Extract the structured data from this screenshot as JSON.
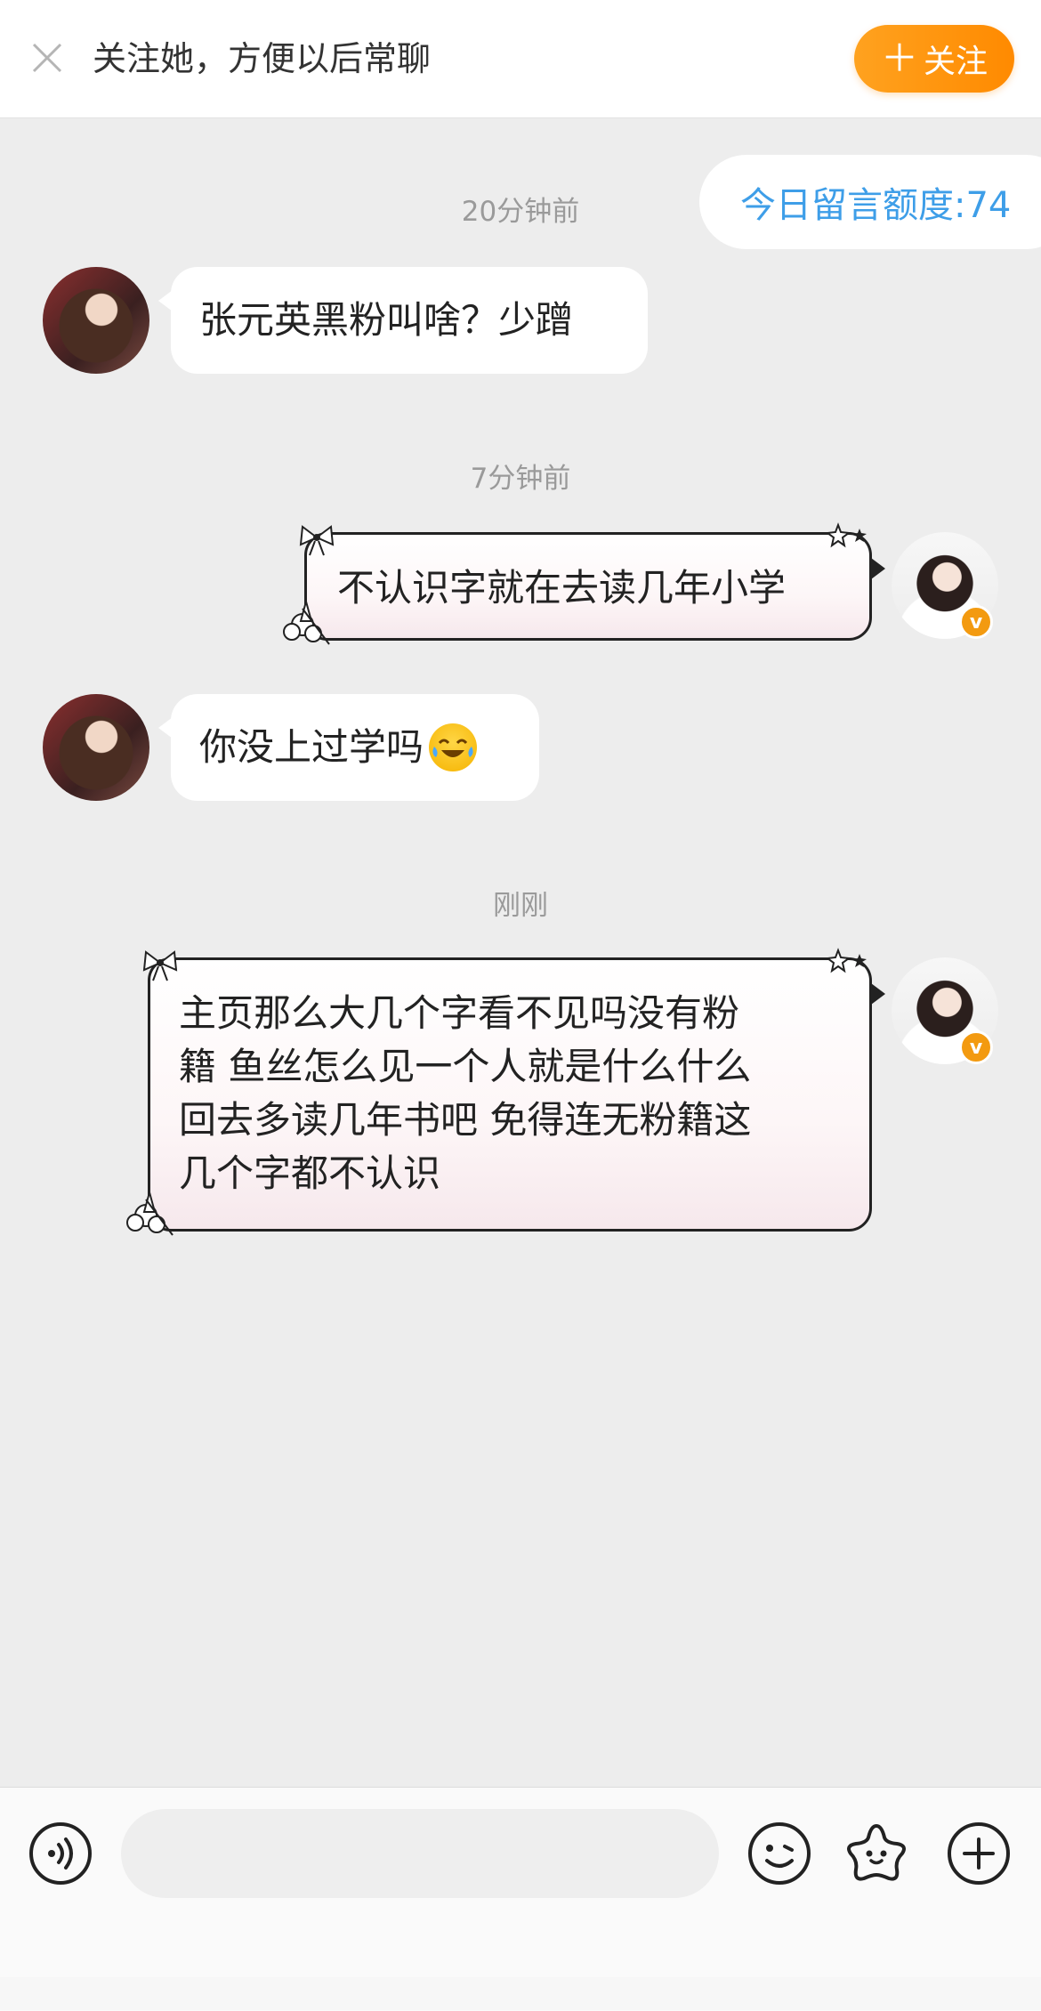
{
  "banner": {
    "title": "关注她，方便以后常聊",
    "follow_label": "关注",
    "follow_plus": "＋"
  },
  "quota": "今日留言额度:74",
  "messages": [
    {
      "time": "20分钟前",
      "from": "them",
      "text": "张元英黑粉叫啥？少蹭"
    },
    {
      "time": "7分钟前",
      "from": "me",
      "text": "不认识字就在去读几年小学"
    },
    {
      "from": "them",
      "text": "你没上过学吗",
      "emoji": "laughing-crying-emoji"
    },
    {
      "time": "刚刚",
      "from": "me",
      "lines": [
        "主页那么大几个字看不见吗没有粉",
        "籍 鱼丝怎么见一个人就是什么什么",
        "回去多读几年书吧 免得连无粉籍这",
        "几个字都不认识"
      ]
    }
  ],
  "verified_badge": "v",
  "input": {
    "value": "",
    "placeholder": ""
  },
  "colors": {
    "accent_orange": "#ff8a00",
    "quota_blue": "#3e9ee8",
    "background": "#ededed"
  },
  "icons": [
    "close-icon",
    "voice-icon",
    "emoji-face-icon",
    "sticker-star-icon",
    "plus-circle-icon"
  ]
}
